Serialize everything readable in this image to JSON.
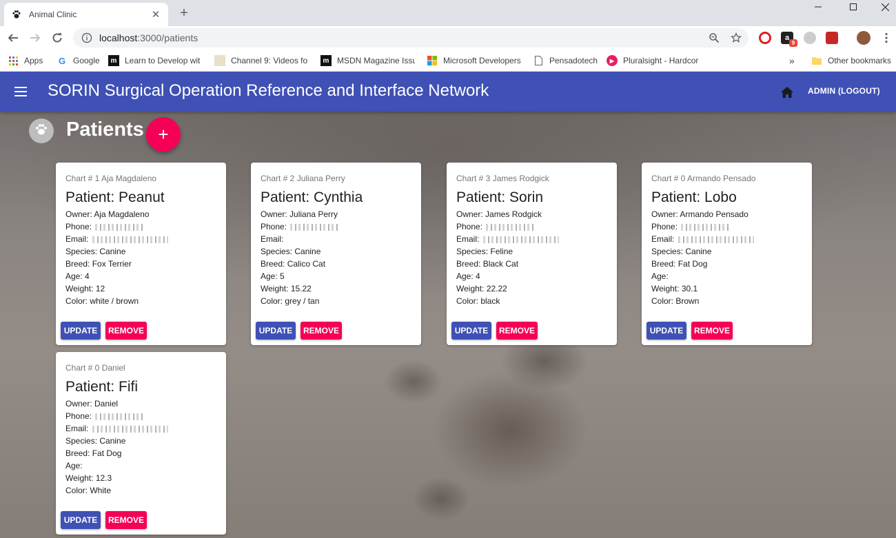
{
  "browser": {
    "tab_title": "Animal Clinic",
    "url_host": "localhost",
    "url_rest": ":3000/patients",
    "bookmarks": [
      {
        "label": "Apps",
        "icon": "apps-grid-icon"
      },
      {
        "label": "Google",
        "icon": "google-icon"
      },
      {
        "label": "Learn to Develop wit",
        "icon": "m-logo-icon"
      },
      {
        "label": "Channel 9: Videos fo",
        "icon": "channel9-icon"
      },
      {
        "label": "MSDN Magazine Issu",
        "icon": "m-logo-icon"
      },
      {
        "label": "Microsoft Developers",
        "icon": "microsoft-icon"
      },
      {
        "label": "Pensadotech",
        "icon": "page-icon"
      },
      {
        "label": "Pluralsight - Hardcor",
        "icon": "pluralsight-icon"
      }
    ],
    "overflow_label": "»",
    "other_bookmarks": "Other bookmarks",
    "extension_badge": "9"
  },
  "app": {
    "title": "SORIN Surgical Operation Reference and Interface Network",
    "logout_label": "ADMIN (LOGOUT)"
  },
  "page": {
    "heading": "Patients",
    "fab_label": "+"
  },
  "labels": {
    "owner": "Owner: ",
    "phone": "Phone: ",
    "email": "Email: ",
    "species": "Species: ",
    "breed": "Breed: ",
    "age": "Age: ",
    "weight": "Weight: ",
    "color": "Color: ",
    "update": "UPDATE",
    "remove": "REMOVE"
  },
  "patients": [
    {
      "chart": "Chart # 1 Aja Magdaleno",
      "name": "Patient: Peanut",
      "owner": "Aja Magdaleno",
      "species": "Canine",
      "breed": "Fox Terrier",
      "age": "4",
      "weight": "12",
      "color": "white / brown"
    },
    {
      "chart": "Chart # 2 Juliana Perry",
      "name": "Patient: Cynthia",
      "owner": "Juliana Perry",
      "species": "Canine",
      "breed": "Calico Cat",
      "age": "5",
      "weight": "15.22",
      "color": "grey / tan"
    },
    {
      "chart": "Chart # 3 James Rodgick",
      "name": "Patient: Sorin",
      "owner": "James Rodgick",
      "species": "Feline",
      "breed": "Black Cat",
      "age": "4",
      "weight": "22.22",
      "color": "black"
    },
    {
      "chart": "Chart # 0 Armando Pensado",
      "name": "Patient: Lobo",
      "owner": "Armando Pensado",
      "species": "Canine",
      "breed": "Fat Dog",
      "age": "",
      "weight": "30.1",
      "color": "Brown"
    },
    {
      "chart": "Chart # 0 Daniel",
      "name": "Patient: Fifi",
      "owner": "Daniel",
      "species": "Canine",
      "breed": "Fat Dog",
      "age": "",
      "weight": "12.3",
      "color": "White"
    }
  ],
  "colors": {
    "appbar": "#3f51b5",
    "accent": "#f50057",
    "update_button": "#3f51b5",
    "remove_button": "#f50057"
  }
}
